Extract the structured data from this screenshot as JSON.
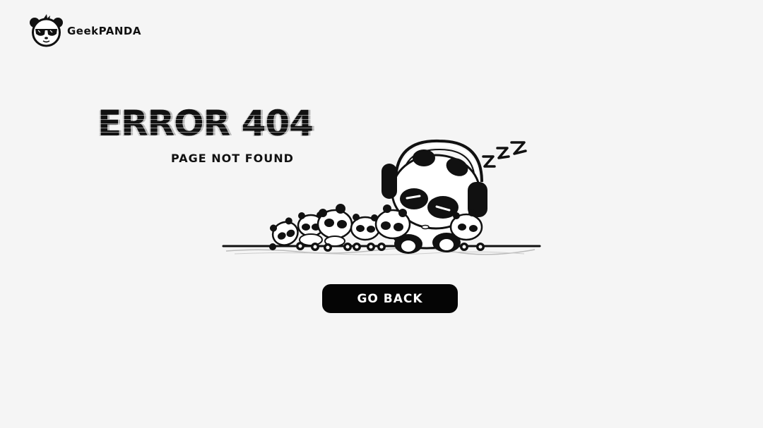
{
  "brand": {
    "name": "GeekPANDA",
    "logo_icon": "panda-sunglasses-icon"
  },
  "error": {
    "title": "ERROR 404",
    "subtitle": "PAGE NOT FOUND"
  },
  "illustration": {
    "icon": "sleeping-pandas-illustration"
  },
  "actions": {
    "go_back_label": "GO BACK"
  },
  "colors": {
    "background": "#f5f5f5",
    "text": "#111111",
    "button_bg": "#050505",
    "button_text": "#ffffff"
  }
}
